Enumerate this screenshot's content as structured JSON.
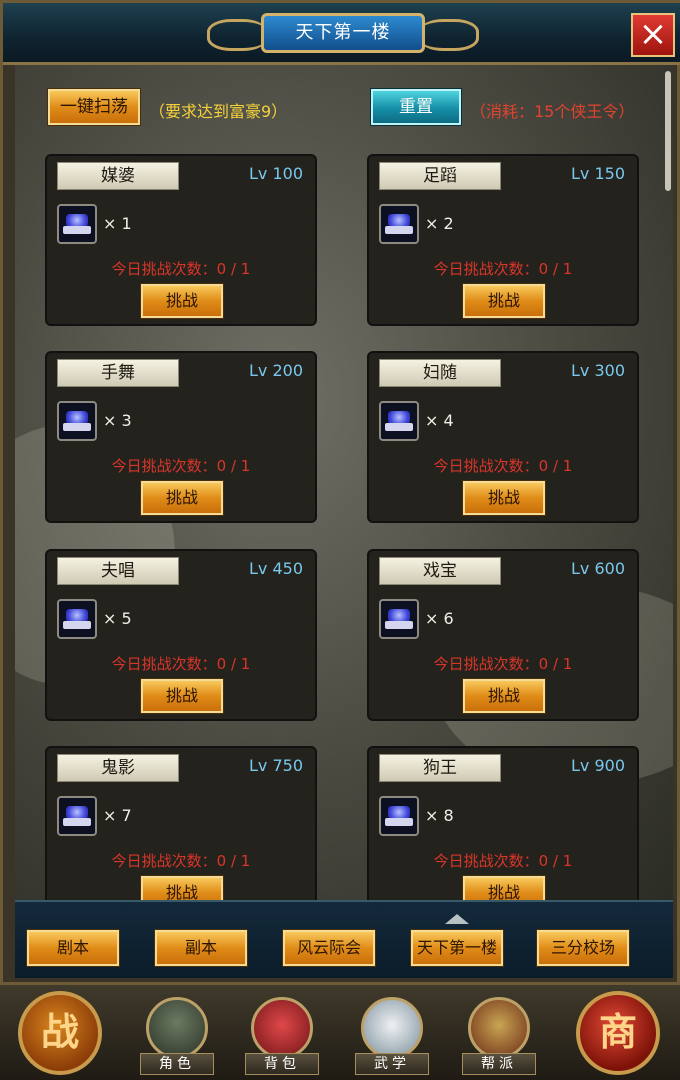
{
  "window": {
    "title": "天下第一楼",
    "close_label": "×"
  },
  "toolbar": {
    "sweep_label": "一键扫荡",
    "sweep_requirement": "（要求达到富豪9）",
    "reset_label": "重置",
    "reset_cost": "（消耗：15个侠王令）"
  },
  "cards": [
    {
      "name": "媒婆",
      "level": "Lv 100",
      "reward_qty": "× 1",
      "count_text": "今日挑战次数：0 / 1",
      "button": "挑战"
    },
    {
      "name": "足蹈",
      "level": "Lv 150",
      "reward_qty": "× 2",
      "count_text": "今日挑战次数：0 / 1",
      "button": "挑战"
    },
    {
      "name": "手舞",
      "level": "Lv 200",
      "reward_qty": "× 3",
      "count_text": "今日挑战次数：0 / 1",
      "button": "挑战"
    },
    {
      "name": "妇随",
      "level": "Lv 300",
      "reward_qty": "× 4",
      "count_text": "今日挑战次数：0 / 1",
      "button": "挑战"
    },
    {
      "name": "夫唱",
      "level": "Lv 450",
      "reward_qty": "× 5",
      "count_text": "今日挑战次数：0 / 1",
      "button": "挑战"
    },
    {
      "name": "戏宝",
      "level": "Lv 600",
      "reward_qty": "× 6",
      "count_text": "今日挑战次数：0 / 1",
      "button": "挑战"
    },
    {
      "name": "鬼影",
      "level": "Lv 750",
      "reward_qty": "× 7",
      "count_text": "今日挑战次数：0 / 1",
      "button": "挑战"
    },
    {
      "name": "狗王",
      "level": "Lv 900",
      "reward_qty": "× 8",
      "count_text": "今日挑战次数：0 / 1",
      "button": "挑战"
    }
  ],
  "tabs": [
    {
      "label": "剧本"
    },
    {
      "label": "副本"
    },
    {
      "label": "风云际会"
    },
    {
      "label": "天下第一楼"
    },
    {
      "label": "三分校场"
    }
  ],
  "bottom_nav": {
    "battle": "战",
    "items": [
      {
        "label": "角色",
        "icon": "role-icon"
      },
      {
        "label": "背包",
        "icon": "bag-icon"
      },
      {
        "label": "武学",
        "icon": "martial-book-icon"
      },
      {
        "label": "帮派",
        "icon": "guild-icon"
      }
    ],
    "shop": "商"
  },
  "colors": {
    "accent_gold": "#e08c18",
    "accent_blue": "#158ea6",
    "warning_red": "#d9362a",
    "level_blue": "#79c8ee"
  }
}
